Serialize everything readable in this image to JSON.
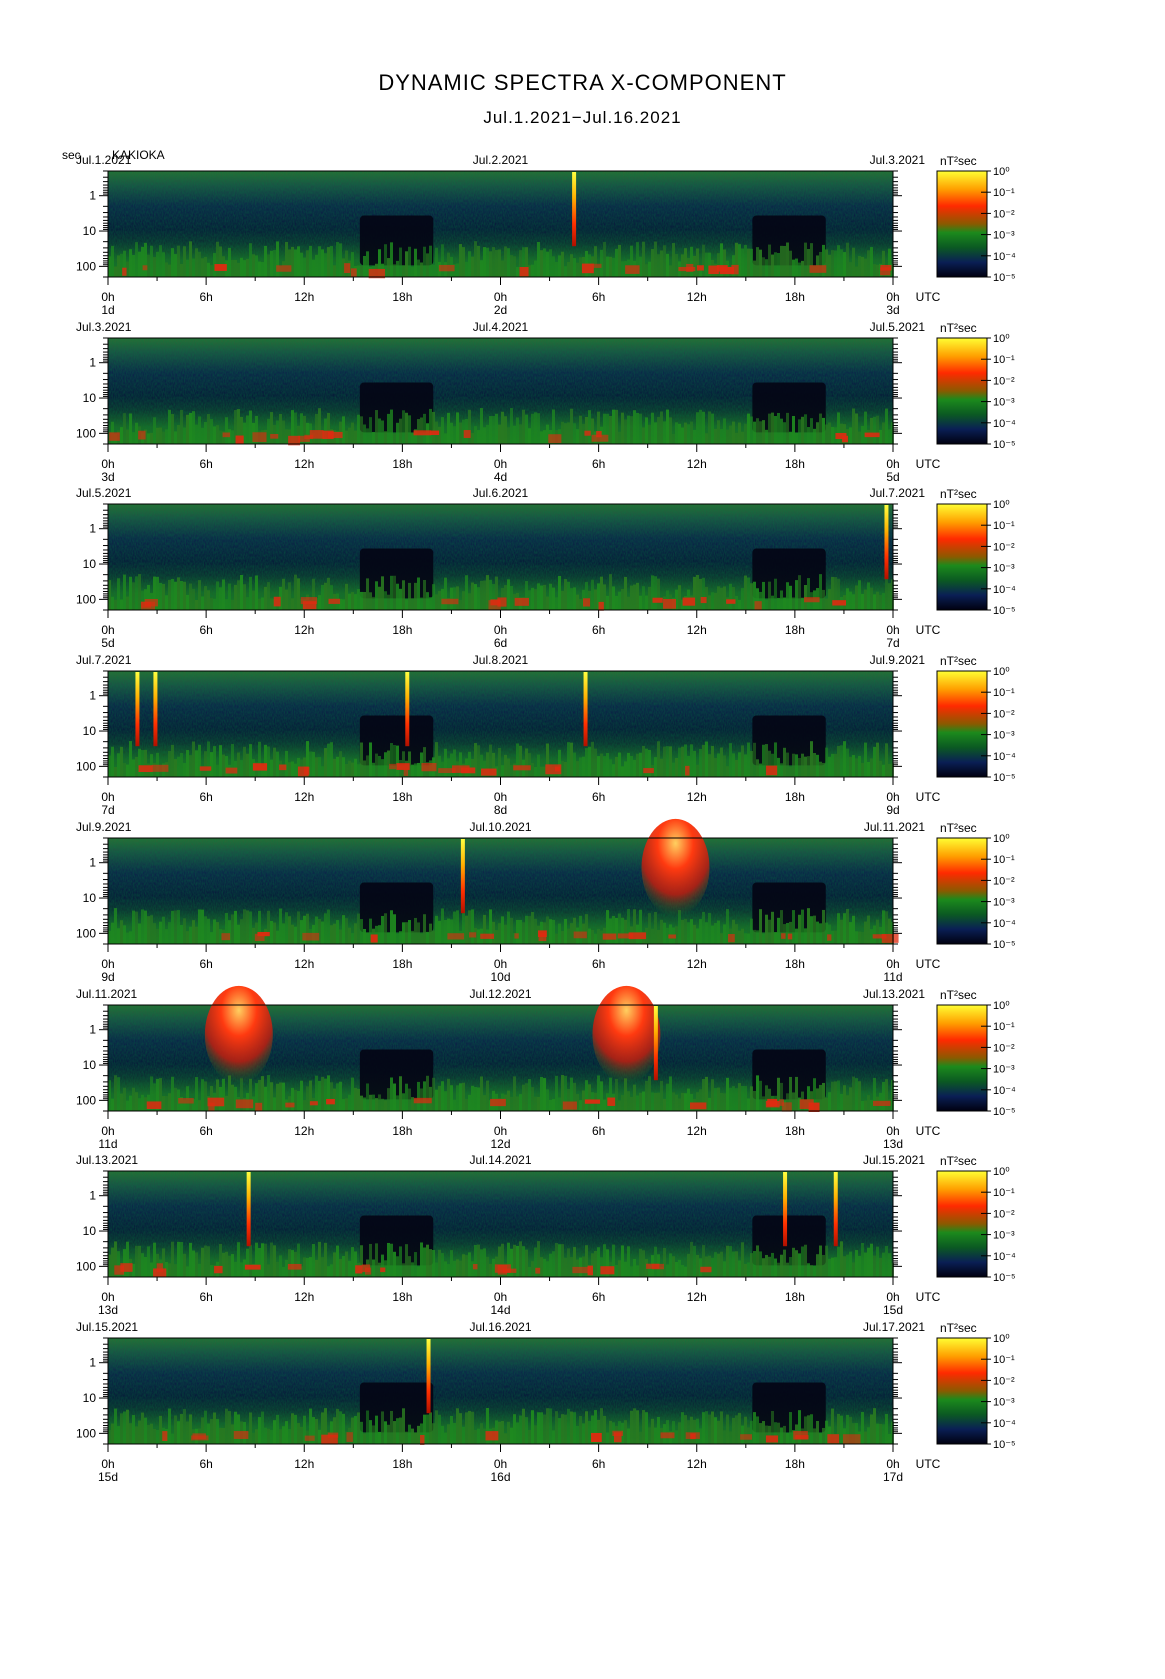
{
  "title": "DYNAMIC SPECTRA X-COMPONENT",
  "subtitle": "Jul.1.2021−Jul.16.2021",
  "unit_label": "sec",
  "station": "KAKIOKA",
  "colorbar_unit": "nT²sec",
  "colorbar_ticks": [
    "10⁰",
    "10⁻¹",
    "10⁻²",
    "10⁻³",
    "10⁻⁴",
    "10⁻⁵"
  ],
  "y_ticks": [
    "1",
    "10",
    "100"
  ],
  "x_tick_labels": [
    "0h",
    "6h",
    "12h",
    "18h",
    "0h",
    "6h",
    "12h",
    "18h",
    "0h"
  ],
  "utc_label": "UTC",
  "chart_data": {
    "type": "heatmap",
    "title": "DYNAMIC SPECTRA X-COMPONENT",
    "ylabel": "sec",
    "yscale": "log",
    "ylim": [
      0.2,
      200
    ],
    "colorbar_label": "nT²sec",
    "color_scale": "log",
    "color_range": [
      1e-05,
      1
    ],
    "panels": [
      {
        "start_label": "Jul.1.2021",
        "mid_label": "Jul.2.2021",
        "end_label": "Jul.3.2021",
        "day_labels": [
          "1d",
          "2d",
          "3d"
        ],
        "events": [
          {
            "hour": 28.5,
            "type": "spike"
          }
        ]
      },
      {
        "start_label": "Jul.3.2021",
        "mid_label": "Jul.4.2021",
        "end_label": "Jul.5.2021",
        "day_labels": [
          "3d",
          "4d",
          "5d"
        ],
        "events": []
      },
      {
        "start_label": "Jul.5.2021",
        "mid_label": "Jul.6.2021",
        "end_label": "Jul.7.2021",
        "day_labels": [
          "5d",
          "6d",
          "7d"
        ],
        "events": [
          {
            "hour": 47.6,
            "type": "spike"
          }
        ]
      },
      {
        "start_label": "Jul.7.2021",
        "mid_label": "Jul.8.2021",
        "end_label": "Jul.9.2021",
        "day_labels": [
          "7d",
          "8d",
          "9d"
        ],
        "events": [
          {
            "hour": 1.8,
            "type": "spike"
          },
          {
            "hour": 2.9,
            "type": "spike"
          },
          {
            "hour": 18.3,
            "type": "spike"
          },
          {
            "hour": 29.2,
            "type": "spike"
          }
        ]
      },
      {
        "start_label": "Jul.9.2021",
        "mid_label": "Jul.10.2021",
        "end_label": "Jul.11.2021",
        "day_labels": [
          "9d",
          "10d",
          "11d"
        ],
        "events": [
          {
            "hour": 21.7,
            "type": "spike"
          },
          {
            "hour": 34.7,
            "type": "burst"
          }
        ]
      },
      {
        "start_label": "Jul.11.2021",
        "mid_label": "Jul.12.2021",
        "end_label": "Jul.13.2021",
        "day_labels": [
          "11d",
          "12d",
          "13d"
        ],
        "events": [
          {
            "hour": 8.0,
            "type": "burst"
          },
          {
            "hour": 31.7,
            "type": "burst"
          },
          {
            "hour": 33.5,
            "type": "spike"
          }
        ]
      },
      {
        "start_label": "Jul.13.2021",
        "mid_label": "Jul.14.2021",
        "end_label": "Jul.15.2021",
        "day_labels": [
          "13d",
          "14d",
          "15d"
        ],
        "events": [
          {
            "hour": 8.6,
            "type": "spike"
          },
          {
            "hour": 41.4,
            "type": "spike"
          },
          {
            "hour": 44.5,
            "type": "spike"
          }
        ]
      },
      {
        "start_label": "Jul.15.2021",
        "mid_label": "Jul.16.2021",
        "end_label": "Jul.17.2021",
        "day_labels": [
          "15d",
          "16d",
          "17d"
        ],
        "events": [
          {
            "hour": 19.6,
            "type": "spike"
          }
        ]
      }
    ]
  }
}
